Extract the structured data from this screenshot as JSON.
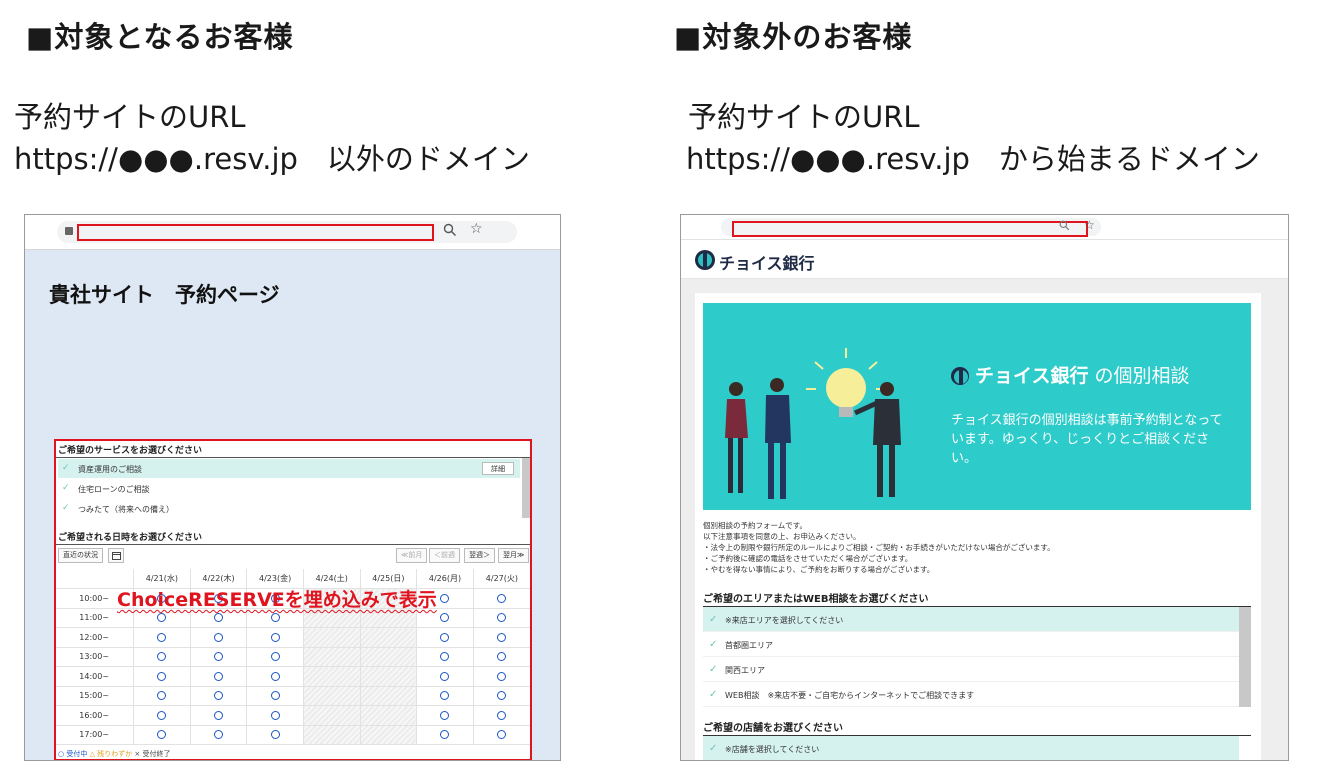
{
  "left": {
    "heading": "■対象となるお客様",
    "url_label": "予約サイトのURL",
    "url_text": "https://●●●.resv.jp　以外のドメイン",
    "page_title": "貴社サイト　予約ページ",
    "embed_label": "ChoiceRESERVEを埋め込みで表示",
    "embed": {
      "service_title": "ご希望のサービスをお選びください",
      "services": [
        {
          "label": "資産運用のご相談",
          "selected": true
        },
        {
          "label": "住宅ローンのご相談",
          "selected": false
        },
        {
          "label": "つみたて（将来への備え）",
          "selected": false
        }
      ],
      "detail_button": "詳細",
      "datetime_title": "ご希望される日時をお選びください",
      "nearby_button": "直近の状況",
      "prev_month": "≪前月",
      "prev_week": "＜前週",
      "next_week": "翌週＞",
      "next_month": "翌月≫",
      "dates": [
        "4/21(水)",
        "4/22(木)",
        "4/23(金)",
        "4/24(土)",
        "4/25(日)",
        "4/26(月)",
        "4/27(火)"
      ],
      "times": [
        "10:00~",
        "11:00~",
        "12:00~",
        "13:00~",
        "14:00~",
        "15:00~",
        "16:00~",
        "17:00~"
      ],
      "legend_open": "○ 受付中",
      "legend_few": "△ 残りわずか",
      "legend_closed": "× 受付終了"
    }
  },
  "right": {
    "heading": "■対象外のお客様",
    "url_label": "予約サイトのURL",
    "url_text": "https://●●●.resv.jp　から始まるドメイン",
    "brand": "チョイス銀行",
    "hero_suffix": " の個別相談",
    "hero_desc": "チョイス銀行の個別相談は事前予約制となっています。ゆっくり、じっくりとご相談ください。",
    "notice": [
      "個別相談の予約フォームです。",
      "以下注意事項を同意の上、お申込みください。",
      "・法令上の制限や銀行所定のルールによりご相談・ご契約・お手続きがいただけない場合がございます。",
      "・ご予約後に確認の電話をさせていただく場合がございます。",
      "・やむを得ない事情により、ご予約をお断りする場合がございます。"
    ],
    "area_title": "ご希望のエリアまたはWEB相談をお選びください",
    "areas": [
      {
        "label": "※来店エリアを選択してください",
        "selected": true
      },
      {
        "label": "首都圏エリア",
        "selected": false
      },
      {
        "label": "関西エリア",
        "selected": false
      },
      {
        "label": "WEB相談　※来店不要・ご自宅からインターネットでご相談できます",
        "selected": false
      }
    ],
    "store_title": "ご希望の店舗をお選びください",
    "stores": [
      {
        "label": "※店舗を選択してください",
        "selected": true
      }
    ]
  },
  "icons": {
    "lock": "lock-icon",
    "zoom": "zoom-icon",
    "star": "star-icon",
    "calendar": "calendar-icon",
    "check": "check-icon",
    "logo": "choice-bank-logo-icon"
  },
  "colors": {
    "highlight_red": "#e0141e",
    "hero_teal": "#2ecbcb",
    "selected_row": "#d6f2ef",
    "page_bg_left": "#dde8f4",
    "slot_blue": "#1a55c9"
  }
}
